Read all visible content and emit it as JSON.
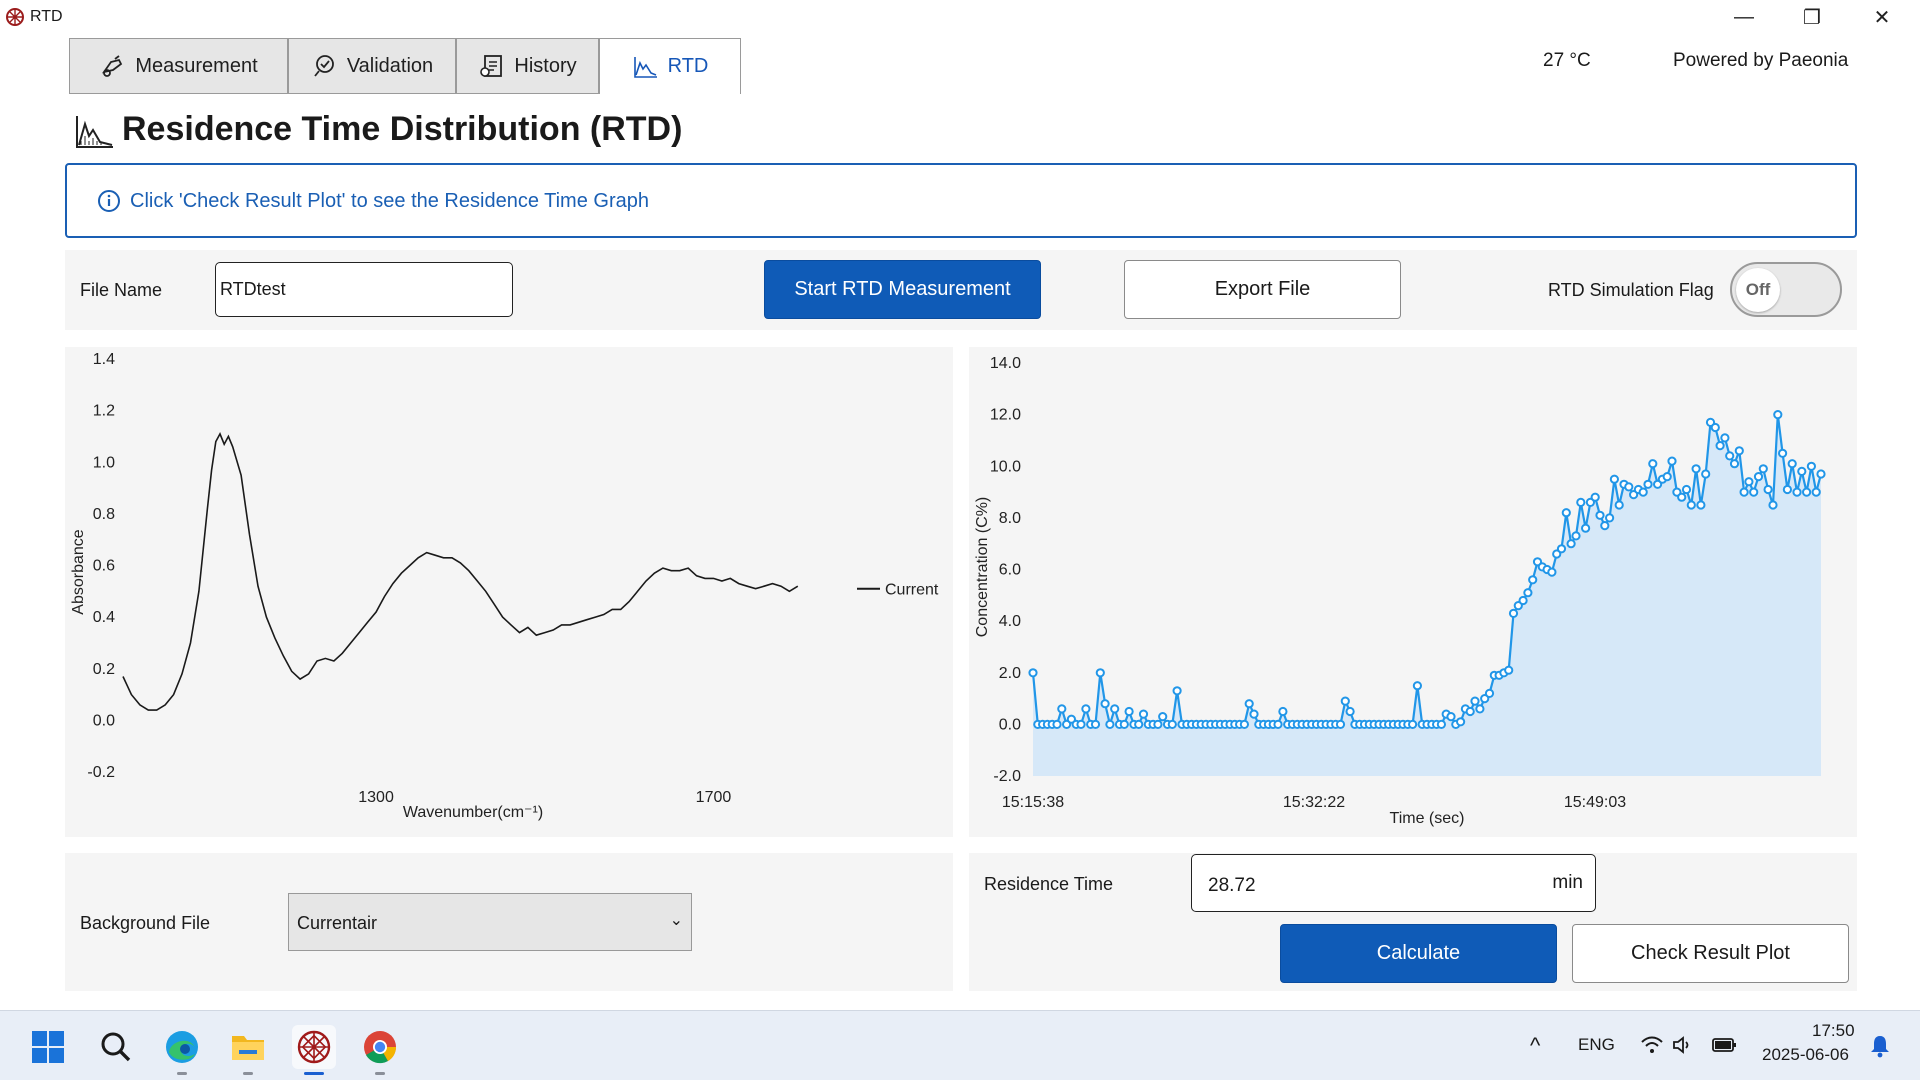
{
  "window": {
    "title": "RTD",
    "controls": {
      "minimize": "—",
      "restore": "❐",
      "close": "✕"
    }
  },
  "tabs": [
    {
      "label": "Measurement",
      "icon": "measurement-icon"
    },
    {
      "label": "Validation",
      "icon": "validation-icon"
    },
    {
      "label": "History",
      "icon": "history-icon"
    },
    {
      "label": "RTD",
      "icon": "rtd-chart-icon",
      "active": true
    }
  ],
  "status": {
    "temperature": "27 °C",
    "powered_by": "Powered by Paeonia"
  },
  "page": {
    "title": "Residence Time Distribution (RTD)"
  },
  "info": {
    "message": "Click 'Check Result Plot' to see the Residence Time Graph"
  },
  "controls": {
    "file_name_label": "File Name",
    "file_name_value": "RTDtest",
    "start_button": "Start RTD Measurement",
    "export_button": "Export File",
    "simulation_label": "RTD Simulation Flag",
    "simulation_toggle": "Off"
  },
  "bottom": {
    "background_label": "Background File",
    "background_value": "Currentair",
    "residence_label": "Residence Time",
    "residence_value": "28.72",
    "residence_unit": "min",
    "calculate_button": "Calculate",
    "check_button": "Check Result Plot"
  },
  "colors": {
    "accent": "#0f5bb7",
    "info": "#1a5fb4",
    "series": "#2196e8",
    "fill": "#d6e8f8"
  },
  "chart_data": [
    {
      "type": "line",
      "title": "",
      "xlabel": "Wavenumber(cm⁻¹)",
      "ylabel": "Absorbance",
      "xlim": [
        1000,
        1850
      ],
      "ylim": [
        -0.2,
        1.4
      ],
      "xticks": [
        1300,
        1700
      ],
      "yticks": [
        "1.4",
        "1.2",
        "1.0",
        "0.8",
        "0.6",
        "0.4",
        "0.2",
        "0.0",
        "-0.2"
      ],
      "legend": {
        "position": "right",
        "entries": [
          "Current"
        ]
      },
      "grid": false,
      "series": [
        {
          "name": "Current",
          "x": [
            1000,
            1010,
            1020,
            1030,
            1040,
            1050,
            1060,
            1070,
            1080,
            1090,
            1100,
            1105,
            1110,
            1115,
            1120,
            1125,
            1130,
            1140,
            1150,
            1160,
            1170,
            1180,
            1190,
            1200,
            1210,
            1220,
            1230,
            1240,
            1250,
            1260,
            1270,
            1280,
            1290,
            1300,
            1310,
            1320,
            1330,
            1340,
            1350,
            1360,
            1370,
            1380,
            1390,
            1400,
            1410,
            1420,
            1430,
            1440,
            1450,
            1460,
            1470,
            1480,
            1490,
            1500,
            1510,
            1520,
            1530,
            1540,
            1550,
            1560,
            1570,
            1580,
            1590,
            1600,
            1610,
            1620,
            1630,
            1640,
            1650,
            1660,
            1670,
            1680,
            1690,
            1700,
            1710,
            1720,
            1730,
            1740,
            1750,
            1760,
            1770,
            1780,
            1790,
            1800
          ],
          "y": [
            0.17,
            0.1,
            0.06,
            0.04,
            0.04,
            0.06,
            0.1,
            0.18,
            0.3,
            0.5,
            0.82,
            0.97,
            1.08,
            1.11,
            1.07,
            1.1,
            1.06,
            0.95,
            0.72,
            0.52,
            0.4,
            0.32,
            0.25,
            0.19,
            0.16,
            0.18,
            0.23,
            0.24,
            0.23,
            0.26,
            0.3,
            0.34,
            0.38,
            0.42,
            0.48,
            0.53,
            0.57,
            0.6,
            0.63,
            0.65,
            0.64,
            0.63,
            0.63,
            0.61,
            0.58,
            0.54,
            0.5,
            0.45,
            0.4,
            0.37,
            0.34,
            0.36,
            0.33,
            0.34,
            0.35,
            0.37,
            0.37,
            0.38,
            0.39,
            0.4,
            0.41,
            0.43,
            0.43,
            0.46,
            0.5,
            0.54,
            0.57,
            0.59,
            0.58,
            0.58,
            0.59,
            0.56,
            0.55,
            0.55,
            0.54,
            0.55,
            0.53,
            0.52,
            0.51,
            0.52,
            0.53,
            0.52,
            0.5,
            0.52
          ]
        }
      ]
    },
    {
      "type": "area",
      "title": "",
      "xlabel": "Time (sec)",
      "ylabel": "Concentration (C%)",
      "xticks": [
        "15:15:38",
        "15:32:22",
        "15:49:03"
      ],
      "ylim": [
        -2.0,
        14.0
      ],
      "yticks": [
        "14.0",
        "12.0",
        "10.0",
        "8.0",
        "6.0",
        "4.0",
        "2.0",
        "0.0",
        "-2.0"
      ],
      "grid": false,
      "series": [
        {
          "name": "",
          "values": [
            2.0,
            0.0,
            0.0,
            0.0,
            0.0,
            0.0,
            0.6,
            0.0,
            0.2,
            0.0,
            0.0,
            0.6,
            0.0,
            0.0,
            2.0,
            0.8,
            0.0,
            0.6,
            0.0,
            0.0,
            0.5,
            0.0,
            0.0,
            0.4,
            0.0,
            0.0,
            0.0,
            0.3,
            0.0,
            0.0,
            1.3,
            0.0,
            0.0,
            0.0,
            0.0,
            0.0,
            0.0,
            0.0,
            0.0,
            0.0,
            0.0,
            0.0,
            0.0,
            0.0,
            0.0,
            0.8,
            0.4,
            0.0,
            0.0,
            0.0,
            0.0,
            0.0,
            0.5,
            0.0,
            0.0,
            0.0,
            0.0,
            0.0,
            0.0,
            0.0,
            0.0,
            0.0,
            0.0,
            0.0,
            0.0,
            0.9,
            0.5,
            0.0,
            0.0,
            0.0,
            0.0,
            0.0,
            0.0,
            0.0,
            0.0,
            0.0,
            0.0,
            0.0,
            0.0,
            0.0,
            1.5,
            0.0,
            0.0,
            0.0,
            0.0,
            0.0,
            0.4,
            0.3,
            0.0,
            0.1,
            0.6,
            0.5,
            0.9,
            0.6,
            1.0,
            1.2,
            1.9,
            1.9,
            2.0,
            2.1,
            4.3,
            4.6,
            4.8,
            5.1,
            5.6,
            6.3,
            6.1,
            6.0,
            5.9,
            6.6,
            6.8,
            8.2,
            7.0,
            7.3,
            8.6,
            7.6,
            8.6,
            8.8,
            8.1,
            7.7,
            8.0,
            9.5,
            8.5,
            9.3,
            9.2,
            8.9,
            9.1,
            9.0,
            9.3,
            10.1,
            9.3,
            9.5,
            9.6,
            10.2,
            9.0,
            8.8,
            9.1,
            8.5,
            9.9,
            8.5,
            9.7,
            11.7,
            11.5,
            10.8,
            11.1,
            10.4,
            10.1,
            10.6,
            9.0,
            9.4,
            9.0,
            9.6,
            9.9,
            9.1,
            8.5,
            12.0,
            10.5,
            9.1,
            10.1,
            9.0,
            9.8,
            9.0,
            10.0,
            9.0,
            9.7
          ]
        }
      ]
    }
  ],
  "taskbar": {
    "apps": [
      "windows-start-icon",
      "search-icon",
      "edge-browser-icon",
      "file-explorer-icon",
      "rtd-app-icon",
      "chrome-icon"
    ],
    "tray": {
      "chevron": "^",
      "language": "ENG",
      "time": "17:50",
      "date": "2025-06-06"
    }
  }
}
